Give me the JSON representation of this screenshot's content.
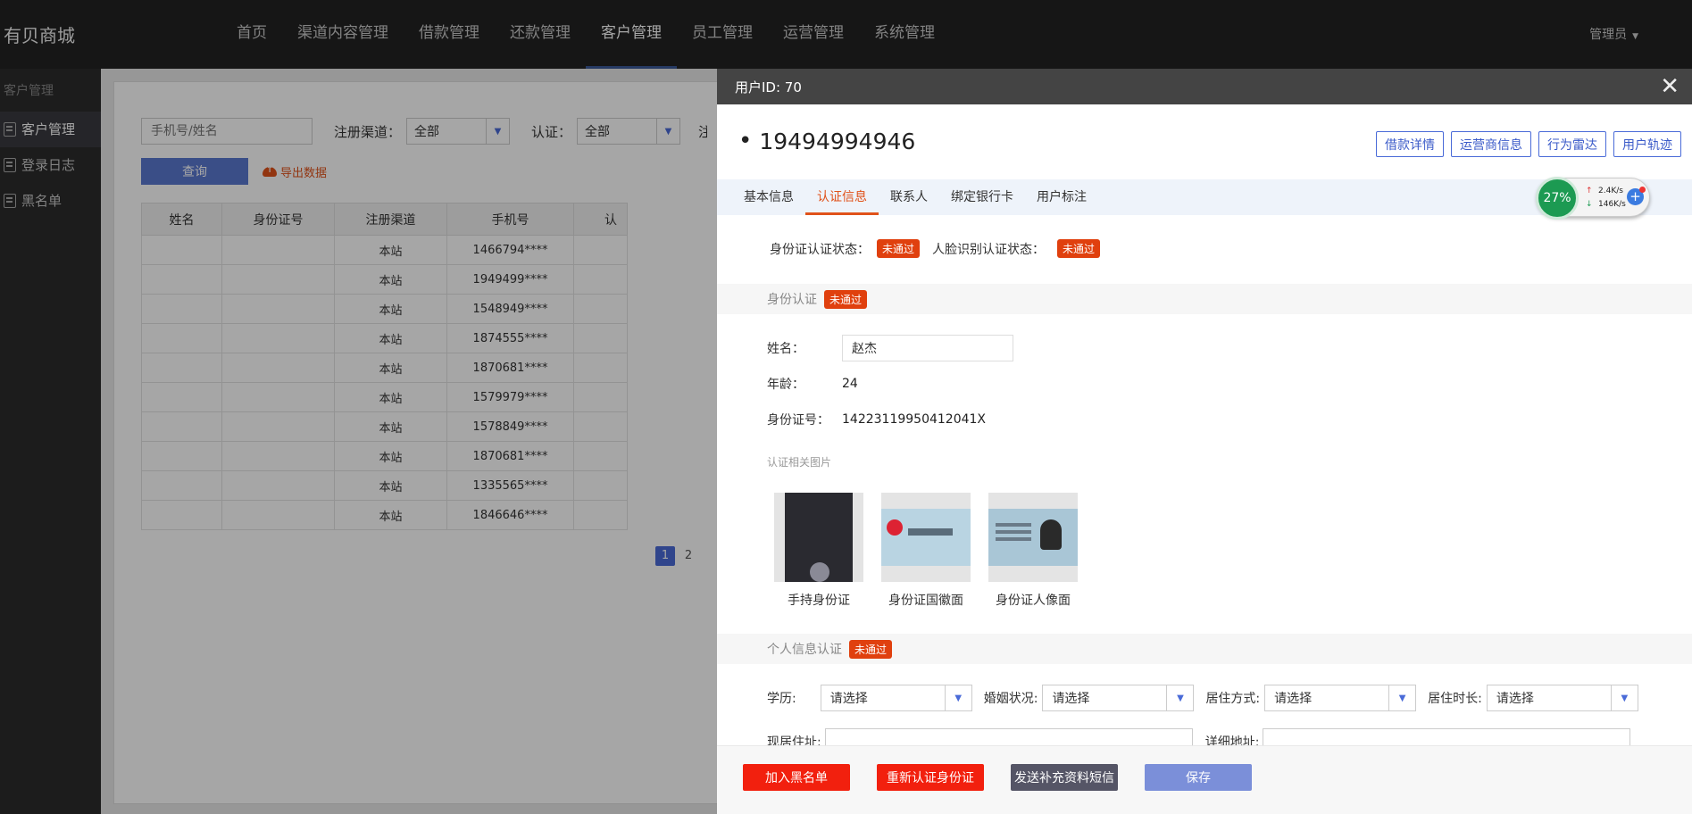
{
  "app": {
    "logo": "有贝商城"
  },
  "nav": [
    "首页",
    "渠道内容管理",
    "借款管理",
    "还款管理",
    "客户管理",
    "员工管理",
    "运营管理",
    "系统管理"
  ],
  "nav_active": 4,
  "user_menu": {
    "label": "管理员",
    "caret": "▼"
  },
  "sidebar": {
    "title": "客户管理",
    "items": [
      {
        "label": "客户管理"
      },
      {
        "label": "登录日志"
      },
      {
        "label": "黑名单"
      }
    ]
  },
  "list": {
    "search_placeholder": "手机号/姓名",
    "filter_channel_label": "注册渠道：",
    "filter_channel_value": "全部",
    "filter_auth_label": "认证：",
    "filter_auth_value": "全部",
    "filter_cut_label": "注",
    "query_button": "查询",
    "export_link": "导出数据",
    "columns": [
      "姓名",
      "身份证号",
      "注册渠道",
      "手机号",
      "认"
    ],
    "rows": [
      {
        "name": "",
        "idno": "",
        "channel": "本站",
        "phone": "1466794****"
      },
      {
        "name": "",
        "idno": "",
        "channel": "本站",
        "phone": "1949499****"
      },
      {
        "name": "",
        "idno": "",
        "channel": "本站",
        "phone": "1548949****"
      },
      {
        "name": "",
        "idno": "",
        "channel": "本站",
        "phone": "1874555****"
      },
      {
        "name": "",
        "idno": "",
        "channel": "本站",
        "phone": "1870681****"
      },
      {
        "name": "",
        "idno": "",
        "channel": "本站",
        "phone": "1579979****"
      },
      {
        "name": "",
        "idno": "",
        "channel": "本站",
        "phone": "1578849****"
      },
      {
        "name": "",
        "idno": "",
        "channel": "本站",
        "phone": "1870681****"
      },
      {
        "name": "",
        "idno": "",
        "channel": "本站",
        "phone": "1335565****"
      },
      {
        "name": "",
        "idno": "",
        "channel": "本站",
        "phone": "1846646****"
      }
    ],
    "pages": [
      "1",
      "2"
    ]
  },
  "modal": {
    "title": "用户ID: 70",
    "close": "✕",
    "phone": "19494994946",
    "actions": [
      "借款详情",
      "运营商信息",
      "行为雷达",
      "用户轨迹"
    ],
    "tabs": [
      "基本信息",
      "认证信息",
      "联系人",
      "绑定银行卡",
      "用户标注"
    ],
    "active_tab": 1,
    "id_status_label": "身份证认证状态：",
    "id_status": "未通过",
    "face_status_label": "人脸识别认证状态：",
    "face_status": "未通过",
    "id_section": {
      "title": "身份认证",
      "badge": "未通过"
    },
    "name_label": "姓名：",
    "name_value": "赵杰",
    "age_label": "年龄：",
    "age_value": "24",
    "idno_label": "身份证号：",
    "idno_value": "14223119950412041X",
    "photos_label": "认证相关图片",
    "photos": [
      "手持身份证",
      "身份证国徽面",
      "身份证人像面"
    ],
    "personal_section": {
      "title": "个人信息认证",
      "badge": "未通过"
    },
    "selects": [
      {
        "label": "学历:",
        "value": "请选择"
      },
      {
        "label": "婚姻状况:",
        "value": "请选择"
      },
      {
        "label": "居住方式:",
        "value": "请选择"
      },
      {
        "label": "居住时长:",
        "value": "请选择"
      }
    ],
    "address_label": "现居住址:",
    "detail_address_label": "详细地址:",
    "footer_buttons": [
      {
        "label": "加入黑名单",
        "color": "#f2200e"
      },
      {
        "label": "重新认证身份证",
        "color": "#f2200e"
      },
      {
        "label": "发送补充资料短信",
        "color": "#555566"
      },
      {
        "label": "保存",
        "color": "#7b8fd9"
      }
    ]
  },
  "speed_widget": {
    "percent": "27%",
    "up": "2.4K/s",
    "down": "146K/s",
    "up_arrow": "↑",
    "down_arrow": "↓",
    "plus": "+"
  },
  "colors": {
    "accent": "#4a6bd8",
    "danger": "#e0400e",
    "topbar": "#222222"
  }
}
